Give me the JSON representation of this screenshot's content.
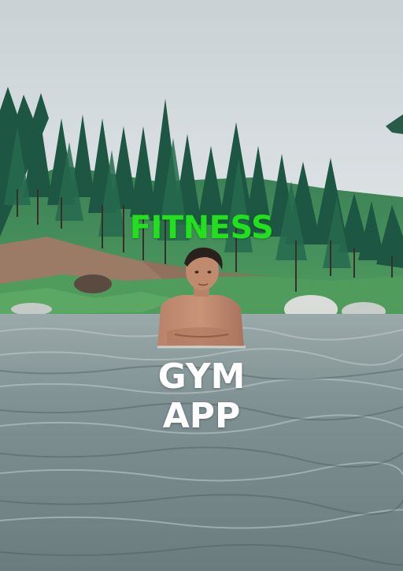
{
  "poster": {
    "headline": "FITNESS",
    "line1": "GYM",
    "line2": "APP"
  },
  "colors": {
    "headline": "#22e01c",
    "body_text": "#ffffff",
    "sky": "#d7dde0",
    "forest": "#1f5a44",
    "water": "#7b8e90"
  },
  "image": {
    "icon": "river-forest-photo"
  }
}
